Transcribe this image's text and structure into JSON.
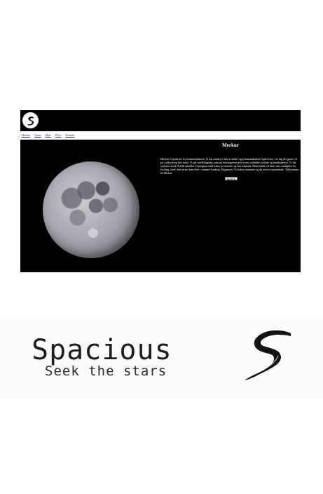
{
  "site": {
    "logo_icon": "spacious-s-logo-icon",
    "nav": [
      "Merkur",
      "Venus",
      "Mars",
      "Pluto",
      "Kontakt"
    ],
    "heading": "Merkur",
    "paragraph": "Merkur er planeten for kommunikation. Vi har samlet et hav af bøker og kommunikations-opleveiser, for dig der gerne vil på i udfordring hen ment. Vi går udviklingsteg, man på musingsteen med vores vidunder kvalitet og mindstpevise. Vi har systemer med 59.620 udvikler til program med fokus på rummet og den tekniske. Hent kände vil dine være mulighed for forskng, rand. den første dam,efter i rummet Andreas Mogensen. Vi elsker rommene og du service opmøtende. Velkommen til Merkur.",
    "button_label": "Bestill nu",
    "colors": {
      "header": "#000000",
      "main": "#000000",
      "nav_link": "#1a1a7a"
    }
  },
  "banner": {
    "name": "Spacious",
    "tagline": "Seek the stars",
    "logo_icon": "brush-s-logo-icon"
  }
}
